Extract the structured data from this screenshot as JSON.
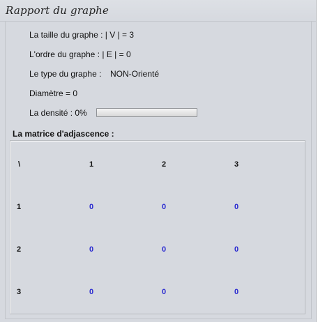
{
  "window": {
    "title": "Rapport du graphe"
  },
  "info": {
    "size_line": "La taille du graphe : | V | = 3",
    "order_line": "L'ordre du graphe : | E | = 0",
    "type_label": "Le type du graphe :",
    "type_value": "NON-Orienté",
    "diameter_line": "Diamètre = 0",
    "density_label": "La densité : 0%",
    "density_progress_percent": 0
  },
  "matrix": {
    "title": "La matrice d'adjascence :",
    "corner": "\\",
    "column_headers": [
      "1",
      "2",
      "3"
    ],
    "row_headers": [
      "1",
      "2",
      "3"
    ],
    "rows": [
      [
        "0",
        "0",
        "0"
      ],
      [
        "0",
        "0",
        "0"
      ],
      [
        "0",
        "0",
        "0"
      ]
    ],
    "value_color": "#2a2ad0"
  }
}
